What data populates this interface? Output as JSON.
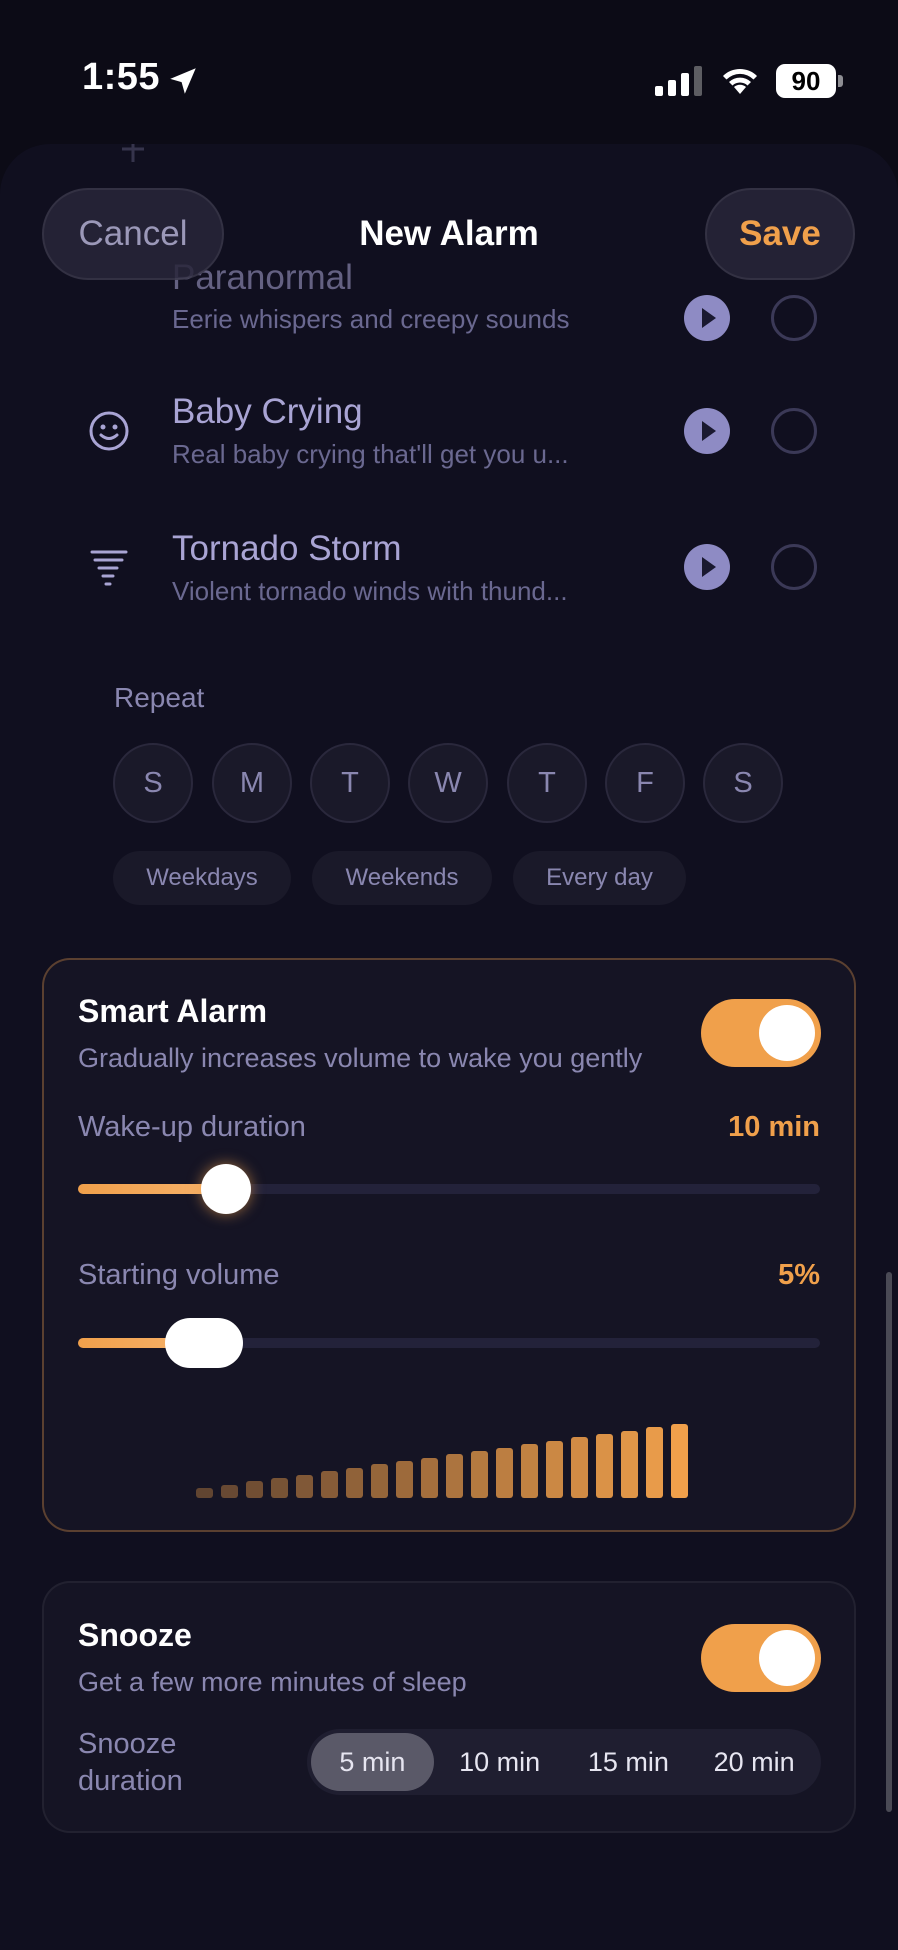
{
  "status": {
    "time": "1:55",
    "battery": "90"
  },
  "nav": {
    "cancel": "Cancel",
    "title": "New Alarm",
    "save": "Save"
  },
  "sounds": [
    {
      "name": "Paranormal",
      "desc": "Eerie whispers and creepy sounds",
      "icon": "ghost-icon"
    },
    {
      "name": "Baby Crying",
      "desc": "Real baby crying that'll get you u...",
      "icon": "smiley-icon"
    },
    {
      "name": "Tornado Storm",
      "desc": "Violent tornado winds with thund...",
      "icon": "tornado-icon"
    }
  ],
  "repeat": {
    "label": "Repeat",
    "days": [
      "S",
      "M",
      "T",
      "W",
      "T",
      "F",
      "S"
    ],
    "presets": [
      "Weekdays",
      "Weekends",
      "Every day"
    ]
  },
  "smart_alarm": {
    "title": "Smart Alarm",
    "subtitle": "Gradually increases volume to wake you gently",
    "enabled": true,
    "wake_label": "Wake-up duration",
    "wake_value": "10 min",
    "wake_fraction": 0.2,
    "volume_label": "Starting volume",
    "volume_value": "5%",
    "volume_fraction": 0.17
  },
  "snooze": {
    "title": "Snooze",
    "subtitle": "Get a few more minutes of sleep",
    "enabled": true,
    "duration_label_1": "Snooze",
    "duration_label_2": "duration",
    "options": [
      "5 min",
      "10 min",
      "15 min",
      "20 min"
    ],
    "selected": "5 min"
  },
  "colors": {
    "accent": "#f0a04b",
    "background": "#100f1f",
    "muted": "#8a87b0"
  }
}
